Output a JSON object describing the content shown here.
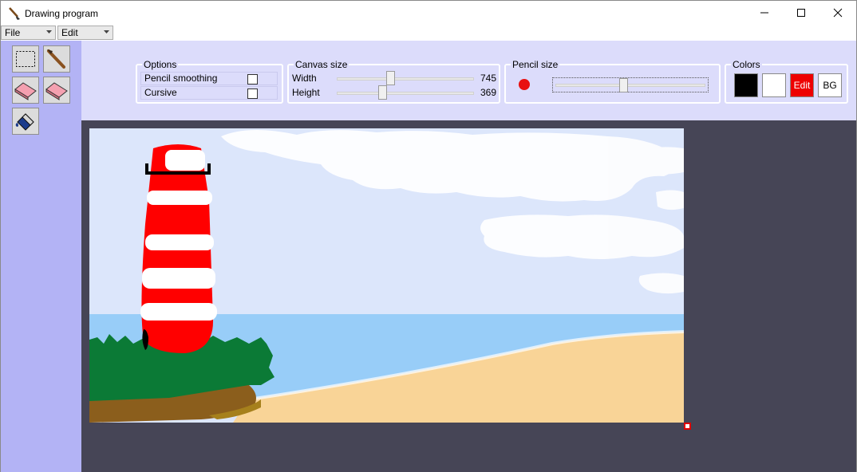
{
  "window": {
    "title": "Drawing program",
    "minimize_label": "minimize",
    "maximize_label": "maximize",
    "close_label": "close"
  },
  "menu": [
    {
      "label": "File"
    },
    {
      "label": "Edit"
    }
  ],
  "tools": [
    {
      "name": "select-tool",
      "icon": "marquee-icon"
    },
    {
      "name": "brush-tool",
      "icon": "paintbrush-icon"
    },
    {
      "name": "eraser-tool",
      "icon": "eraser-icon"
    },
    {
      "name": "eraser-large-tool",
      "icon": "eraser-icon"
    },
    {
      "name": "fill-tool",
      "icon": "paint-bucket-icon"
    }
  ],
  "options": {
    "title": "Options",
    "pencil_smoothing": {
      "label": "Pencil smoothing",
      "checked": false
    },
    "cursive": {
      "label": "Cursive",
      "checked": false
    }
  },
  "canvas_size": {
    "title": "Canvas size",
    "width": {
      "label": "Width",
      "value": "745",
      "fraction": 0.39
    },
    "height": {
      "label": "Height",
      "value": "369",
      "fraction": 0.33
    }
  },
  "pencil_size": {
    "title": "Pencil size",
    "preview_color": "#e81010",
    "fraction": 0.45
  },
  "colors": {
    "title": "Colors",
    "primary": "#000000",
    "secondary": "#ffffff",
    "edit_label": "Edit",
    "edit_color": "#ee0000",
    "bg_label": "BG"
  },
  "theme": {
    "panel_bg": "#b3b3f5",
    "strip_bg": "#dcdcfb",
    "workspace_bg": "#464556",
    "canvas_bg": "#dce6fb"
  }
}
